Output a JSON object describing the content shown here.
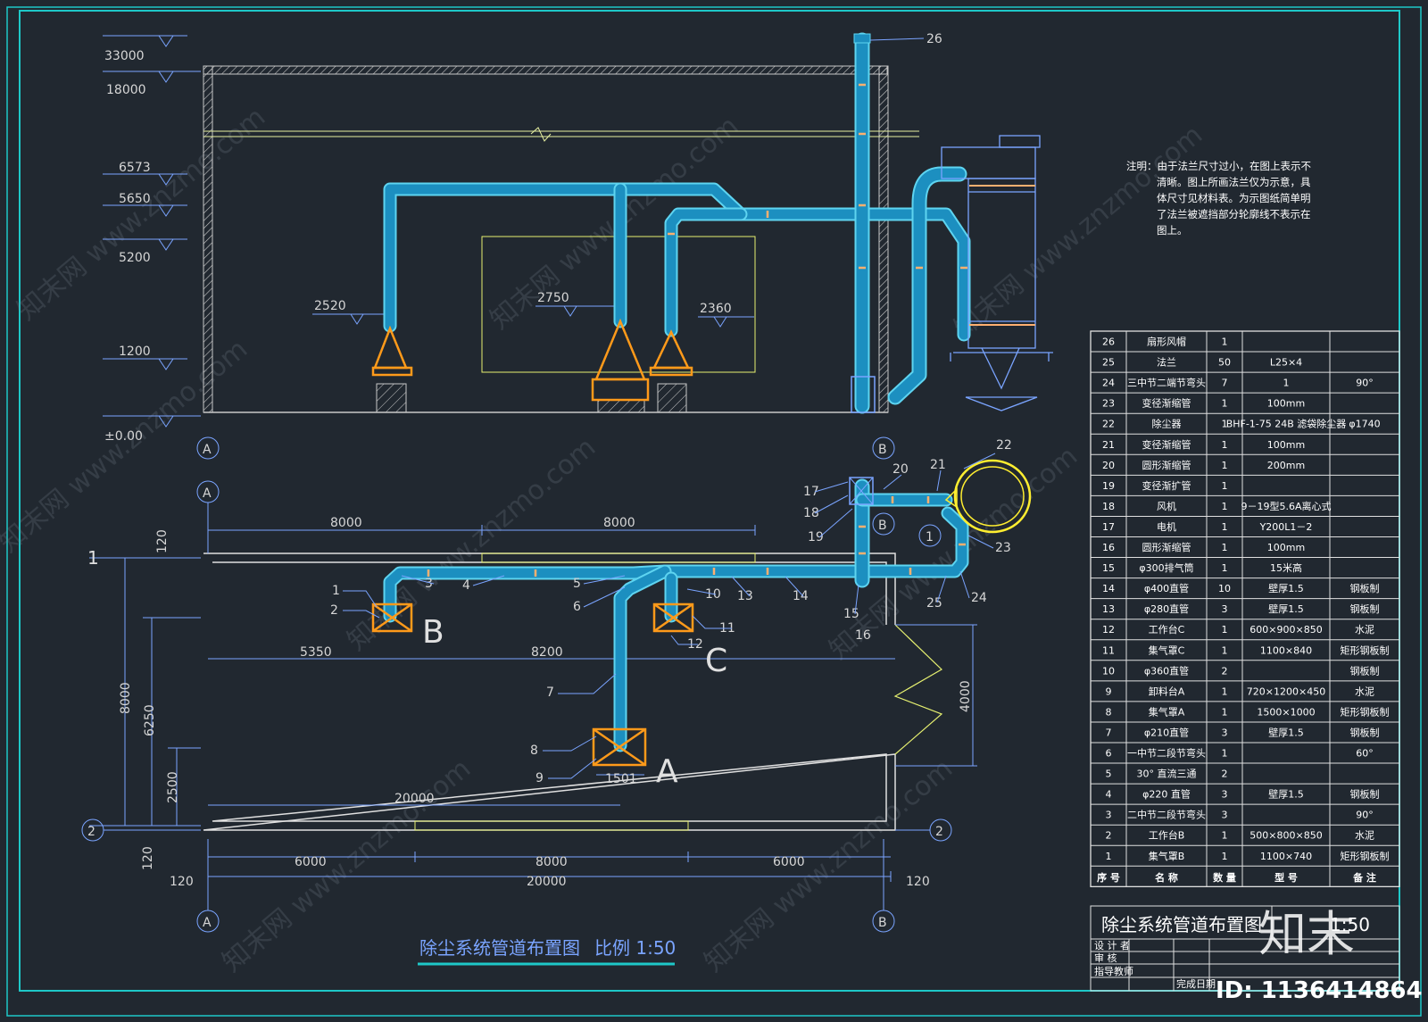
{
  "drawing": {
    "title": "除尘系统管道布置图",
    "scale_label": "比例 1:50",
    "title_block_title": "除尘系统管道布置图",
    "title_block_scale": "1:50"
  },
  "elevation": {
    "levels": [
      "33000",
      "18000",
      "6573",
      "5650",
      "5200",
      "1200",
      "±0.00"
    ],
    "hood_heights": [
      "2520",
      "2750",
      "2360"
    ],
    "axes": [
      "A",
      "B"
    ]
  },
  "plan": {
    "axes": [
      "A",
      "B",
      "1",
      "2"
    ],
    "top_dims": [
      "8000",
      "8000"
    ],
    "bottom_dims": [
      "6000",
      "8000",
      "6000"
    ],
    "overall": "20000",
    "offsets": [
      "120",
      "120"
    ],
    "left_dims": [
      "8000",
      "6250",
      "2500",
      "120",
      "120"
    ],
    "inner_dims": [
      "5350",
      "8200",
      "20000",
      "1501",
      "4000"
    ],
    "station_labels": [
      "A",
      "B",
      "C"
    ],
    "callouts": [
      "1",
      "2",
      "3",
      "4",
      "5",
      "6",
      "7",
      "8",
      "9",
      "10",
      "11",
      "12",
      "13",
      "14",
      "15",
      "16",
      "17",
      "18",
      "19",
      "20",
      "21",
      "22",
      "23",
      "24",
      "25",
      "26"
    ]
  },
  "notes": {
    "lines": [
      "注明：由于法兰尺寸过小，在图上表示不",
      "清晰。图上所画法兰仅为示意，具",
      "体尺寸见材料表。为示图纸简单明",
      "了法兰被遮挡部分轮廓线不表示在",
      "图上。"
    ]
  },
  "bom": {
    "headers": [
      "序 号",
      "名 称",
      "数 量",
      "型 号",
      "备 注"
    ],
    "rows": [
      [
        "26",
        "扇形风帽",
        "1",
        "",
        ""
      ],
      [
        "25",
        "法兰",
        "50",
        "L25×4",
        ""
      ],
      [
        "24",
        "三中节二端节弯头",
        "7",
        "1",
        "90°"
      ],
      [
        "23",
        "变径渐缩管",
        "1",
        "100mm",
        ""
      ],
      [
        "22",
        "除尘器",
        "1",
        "BHF-1-75 24B 滤袋除尘器",
        "φ1740"
      ],
      [
        "21",
        "变径渐缩管",
        "1",
        "100mm",
        ""
      ],
      [
        "20",
        "圆形渐缩管",
        "1",
        "200mm",
        ""
      ],
      [
        "19",
        "变径渐扩管",
        "1",
        "",
        ""
      ],
      [
        "18",
        "风机",
        "1",
        "9－19型5.6A离心式",
        ""
      ],
      [
        "17",
        "电机",
        "1",
        "Y200L1－2",
        ""
      ],
      [
        "16",
        "圆形渐缩管",
        "1",
        "100mm",
        ""
      ],
      [
        "15",
        "φ300排气筒",
        "1",
        "15米高",
        ""
      ],
      [
        "14",
        "φ400直管",
        "10",
        "壁厚1.5",
        "钢板制"
      ],
      [
        "13",
        "φ280直管",
        "3",
        "壁厚1.5",
        "钢板制"
      ],
      [
        "12",
        "工作台C",
        "1",
        "600×900×850",
        "水泥"
      ],
      [
        "11",
        "集气罩C",
        "1",
        "1100×840",
        "矩形钢板制"
      ],
      [
        "10",
        "φ360直管",
        "2",
        "",
        "钢板制"
      ],
      [
        "9",
        "卸料台A",
        "1",
        "720×1200×450",
        "水泥"
      ],
      [
        "8",
        "集气罩A",
        "1",
        "1500×1000",
        "矩形钢板制"
      ],
      [
        "7",
        "φ210直管",
        "3",
        "壁厚1.5",
        "钢板制"
      ],
      [
        "6",
        "一中节二段节弯头",
        "1",
        "",
        "60°"
      ],
      [
        "5",
        "30° 直流三通",
        "2",
        "",
        ""
      ],
      [
        "4",
        "φ220 直管",
        "3",
        "壁厚1.5",
        "钢板制"
      ],
      [
        "3",
        "二中节二段节弯头",
        "3",
        "",
        "90°"
      ],
      [
        "2",
        "工作台B",
        "1",
        "500×800×850",
        "水泥"
      ],
      [
        "1",
        "集气罩B",
        "1",
        "1100×740",
        "矩形钢板制"
      ]
    ]
  },
  "title_block": {
    "rows": [
      "设 计 者",
      "审 核",
      "指导教师",
      "完成日期"
    ]
  },
  "watermark": {
    "text": "知末网 www.znzmo.com",
    "logo": "知末",
    "id": "ID: 1136414864"
  },
  "colors": {
    "background": "#212830",
    "frame": "#1ec8c8",
    "wall": "#c8c8c8",
    "duct": "#1c8fc0",
    "duct_edge": "#5ed4f0",
    "hood": "#ff9a1a",
    "collector": "#ffee30",
    "dim": "#7aa4ff"
  }
}
